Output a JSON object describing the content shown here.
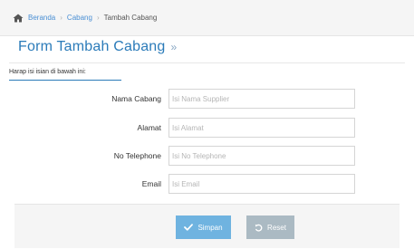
{
  "breadcrumb": {
    "home": "Beranda",
    "section": "Cabang",
    "current": "Tambah Cabang",
    "separator": "›"
  },
  "header": {
    "title": "Form Tambah Cabang",
    "chevron": "»"
  },
  "form": {
    "instruction": "Harap isi isian di bawah ini:",
    "fields": [
      {
        "label": "Nama Cabang",
        "placeholder": "Isi Nama Supplier",
        "value": ""
      },
      {
        "label": "Alamat",
        "placeholder": "Isi Alamat",
        "value": ""
      },
      {
        "label": "No Telephone",
        "placeholder": "Isi No Telephone",
        "value": ""
      },
      {
        "label": "Email",
        "placeholder": "Isi Email",
        "value": ""
      }
    ]
  },
  "actions": {
    "save_label": "Simpan",
    "reset_label": "Reset"
  },
  "colors": {
    "accent": "#2b7bb9",
    "link": "#4a8fd4",
    "save_button": "#6fb3e0",
    "reset_button": "#abbac3"
  },
  "icons": {
    "home": "home-icon",
    "save": "check-icon",
    "reset": "undo-icon"
  }
}
